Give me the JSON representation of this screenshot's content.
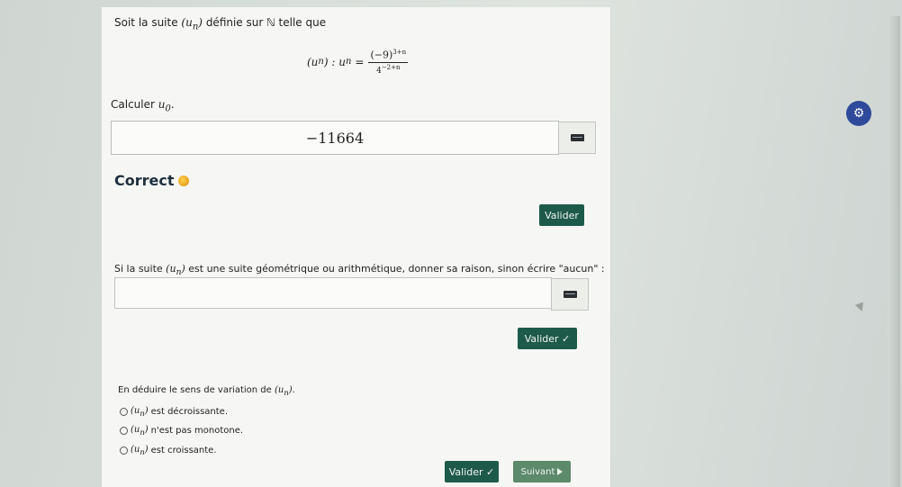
{
  "question1": {
    "prefix": "Soit la suite",
    "seq": "(u",
    "sub": "n",
    "seq_close": ")",
    "suffix": "définie sur ℕ telle que",
    "formula_lhs_seq": "(u",
    "formula_lhs_sub": "n",
    "formula_lhs_close": ") : u",
    "formula_lhs_sub2": "n",
    "formula_eq": "=",
    "numerator_base": "(−9)",
    "numerator_exp": "3+n",
    "denominator_base": "4",
    "denominator_exp": "−2+n",
    "calc_label": "Calculer",
    "calc_var": "u",
    "calc_sub": "0",
    "calc_dot": ".",
    "answer_value": "−11664",
    "correct_label": "Correct",
    "valider_label": "Valider"
  },
  "question2": {
    "prompt_prefix": "Si la suite",
    "prompt_seq": "(u",
    "prompt_sub": "n",
    "prompt_close": ")",
    "prompt_suffix": "est une suite géométrique ou arithmétique, donner sa raison, sinon écrire \"aucun\" :",
    "answer_value": "",
    "valider_label": "Valider ✓"
  },
  "question3": {
    "prompt_prefix": "En déduire le sens de variation de",
    "prompt_seq": "(u",
    "prompt_sub": "n",
    "prompt_close": ").",
    "options": [
      {
        "seq": "(u",
        "sub": "n",
        "close": ")",
        "text": "est décroissante."
      },
      {
        "seq": "(u",
        "sub": "n",
        "close": ")",
        "text": "n'est pas monotone."
      },
      {
        "seq": "(u",
        "sub": "n",
        "close": ")",
        "text": "est croissante."
      }
    ],
    "valider_label": "Valider ✓",
    "suivant_label": "Suivant"
  },
  "colors": {
    "button_green": "#1e5a4a",
    "suivant_green": "#5c8a6b",
    "badge_blue": "#2f4a9a"
  },
  "icons": {
    "keyboard": "keyboard-icon",
    "smiley": "smiley-icon",
    "play": "play-icon",
    "settings_badge": "gear-badge-icon"
  }
}
